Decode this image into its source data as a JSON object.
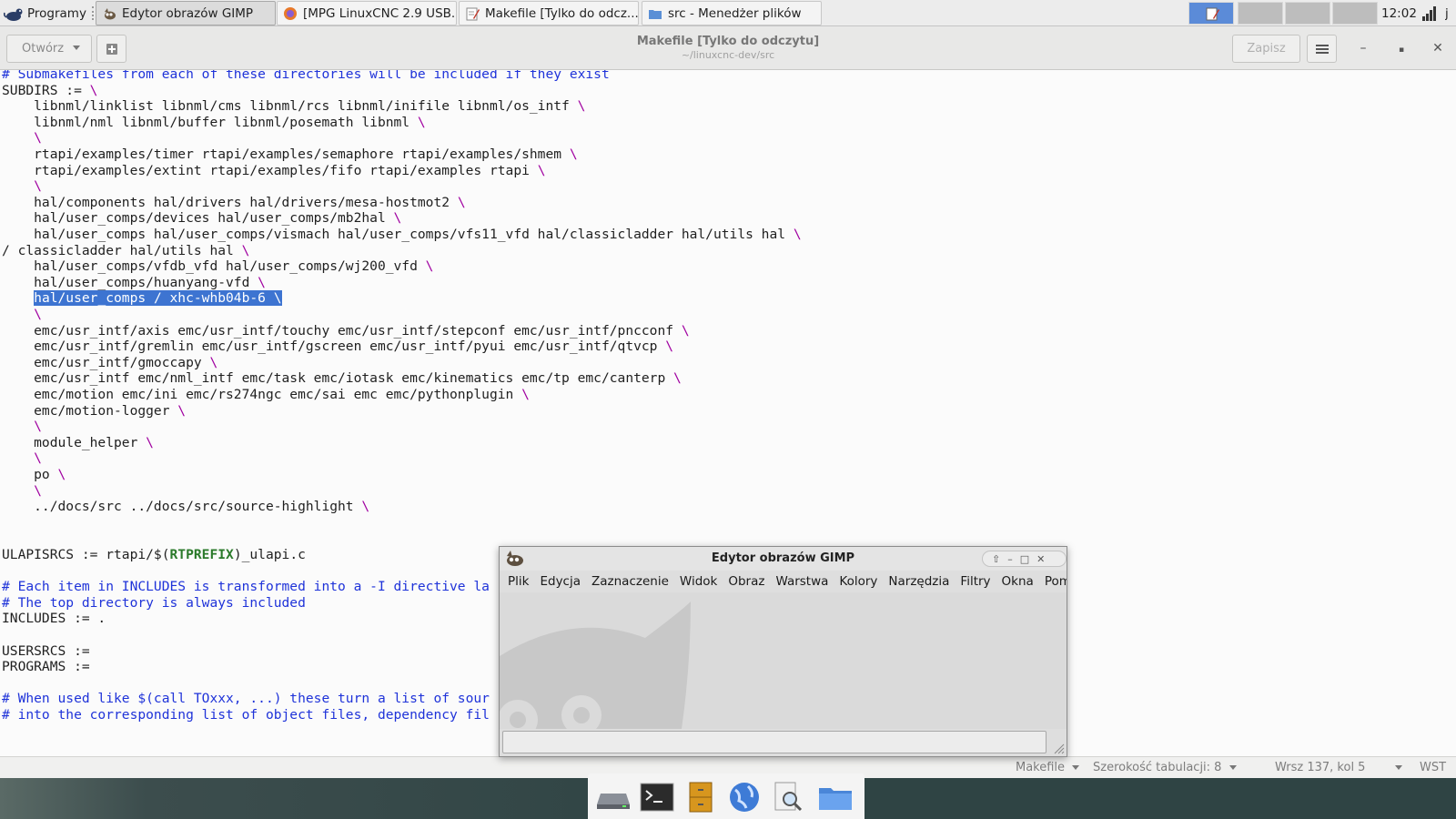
{
  "taskbar": {
    "menu_label": "Programy",
    "tasks": [
      {
        "label": "Edytor obrazów GIMP"
      },
      {
        "label": "[MPG LinuxCNC 2.9 USB..."
      },
      {
        "label": "Makefile [Tylko do odcz..."
      },
      {
        "label": "src - Menedżer plików"
      }
    ],
    "clock": "12:02",
    "user_initial": "j"
  },
  "gedit": {
    "open_label": "Otwórz",
    "save_label": "Zapisz",
    "title": "Makefile [Tylko do odczytu]",
    "subtitle": "~/linuxcnc-dev/src",
    "lines": [
      {
        "text": "# Submakefiles from each of these directories will be included if they exist",
        "type": "cm"
      },
      {
        "text": "SUBDIRS := ",
        "bs": "\\"
      },
      {
        "text": "    libnml/linklist libnml/cms libnml/rcs libnml/inifile libnml/os_intf ",
        "bs": "\\"
      },
      {
        "text": "    libnml/nml libnml/buffer libnml/posemath libnml ",
        "bs": "\\"
      },
      {
        "text": "    ",
        "bs": "\\"
      },
      {
        "text": "    rtapi/examples/timer rtapi/examples/semaphore rtapi/examples/shmem ",
        "bs": "\\"
      },
      {
        "text": "    rtapi/examples/extint rtapi/examples/fifo rtapi/examples rtapi ",
        "bs": "\\"
      },
      {
        "text": "    ",
        "bs": "\\"
      },
      {
        "text": "    hal/components hal/drivers hal/drivers/mesa-hostmot2 ",
        "bs": "\\"
      },
      {
        "text": "    hal/user_comps/devices hal/user_comps/mb2hal ",
        "bs": "\\"
      },
      {
        "text": "    hal/user_comps hal/user_comps/vismach hal/user_comps/vfs11_vfd hal/classicladder hal/utils hal ",
        "bs": "\\"
      },
      {
        "text": "/ classicladder hal/utils hal ",
        "bs": "\\"
      },
      {
        "text": "    hal/user_comps/vfdb_vfd hal/user_comps/wj200_vfd ",
        "bs": "\\"
      },
      {
        "text": "    hal/user_comps/huanyang-vfd ",
        "bs": "\\"
      },
      {
        "text": "    ",
        "sel": "hal/user_comps / xhc-whb04b-6 ",
        "bs": "\\"
      },
      {
        "text": "    ",
        "bs": "\\"
      },
      {
        "text": "    emc/usr_intf/axis emc/usr_intf/touchy emc/usr_intf/stepconf emc/usr_intf/pncconf ",
        "bs": "\\"
      },
      {
        "text": "    emc/usr_intf/gremlin emc/usr_intf/gscreen emc/usr_intf/pyui emc/usr_intf/qtvcp ",
        "bs": "\\"
      },
      {
        "text": "    emc/usr_intf/gmoccapy ",
        "bs": "\\"
      },
      {
        "text": "    emc/usr_intf emc/nml_intf emc/task emc/iotask emc/kinematics emc/tp emc/canterp ",
        "bs": "\\"
      },
      {
        "text": "    emc/motion emc/ini emc/rs274ngc emc/sai emc emc/pythonplugin ",
        "bs": "\\"
      },
      {
        "text": "    emc/motion-logger ",
        "bs": "\\"
      },
      {
        "text": "    ",
        "bs": "\\"
      },
      {
        "text": "    module_helper ",
        "bs": "\\"
      },
      {
        "text": "    ",
        "bs": "\\"
      },
      {
        "text": "    po ",
        "bs": "\\"
      },
      {
        "text": "    ",
        "bs": "\\"
      },
      {
        "text": "    ../docs/src ../docs/src/source-highlight ",
        "bs": "\\"
      },
      {
        "text": ""
      },
      {
        "text": ""
      },
      {
        "text": "ULAPISRCS := rtapi/$(",
        "var": "RTPREFIX",
        "after": ")_ulapi.c"
      },
      {
        "text": ""
      },
      {
        "text": "# Each item in INCLUDES is transformed into a -I directive la",
        "type": "cm"
      },
      {
        "text": "# The top directory is always included",
        "type": "cm"
      },
      {
        "text": "INCLUDES := ."
      },
      {
        "text": ""
      },
      {
        "text": "USERSRCS :="
      },
      {
        "text": "PROGRAMS :="
      },
      {
        "text": ""
      },
      {
        "text": "# When used like $(call TOxxx, ...) these turn a list of sour",
        "type": "cm"
      },
      {
        "text": "# into the corresponding list of object files, dependency fil",
        "type": "cm"
      }
    ],
    "status": {
      "language": "Makefile",
      "tab_width": "Szerokość tabulacji: 8",
      "position": "Wrsz 137, kol 5",
      "mode": "WST"
    }
  },
  "gimp": {
    "title": "Edytor obrazów GIMP",
    "menu": [
      "Plik",
      "Edycja",
      "Zaznaczenie",
      "Widok",
      "Obraz",
      "Warstwa",
      "Kolory",
      "Narzędzia",
      "Filtry",
      "Okna",
      "Pomo"
    ]
  },
  "dock": {
    "icons": [
      "drive-icon",
      "terminal-icon",
      "file-cabinet-icon",
      "web-browser-icon",
      "search-icon",
      "folder-icon"
    ]
  }
}
